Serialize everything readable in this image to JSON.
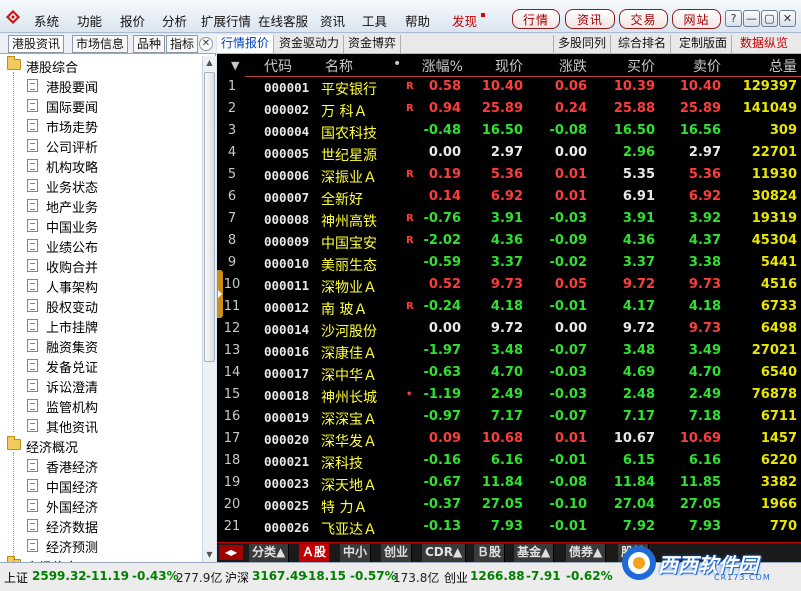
{
  "menu": [
    "系统",
    "功能",
    "报价",
    "分析",
    "扩展行情",
    "在线客服",
    "资讯",
    "工具",
    "帮助"
  ],
  "discover": "发现",
  "top_buttons": [
    "行情",
    "资讯",
    "交易",
    "网站"
  ],
  "window_buttons": [
    "?",
    "—",
    "▢",
    "✕"
  ],
  "left_tabs": [
    "港股资讯",
    "市场信息",
    "品种",
    "指标"
  ],
  "left_close": "✕",
  "tree": [
    {
      "label": "港股综合",
      "type": "folder"
    },
    {
      "label": "港股要闻",
      "type": "doc"
    },
    {
      "label": "国际要闻",
      "type": "doc"
    },
    {
      "label": "市场走势",
      "type": "doc"
    },
    {
      "label": "公司评析",
      "type": "doc"
    },
    {
      "label": "机构攻略",
      "type": "doc"
    },
    {
      "label": "业务状态",
      "type": "doc"
    },
    {
      "label": "地产业务",
      "type": "doc"
    },
    {
      "label": "中国业务",
      "type": "doc"
    },
    {
      "label": "业绩公布",
      "type": "doc"
    },
    {
      "label": "收购合并",
      "type": "doc"
    },
    {
      "label": "人事架构",
      "type": "doc"
    },
    {
      "label": "股权变动",
      "type": "doc"
    },
    {
      "label": "上市挂牌",
      "type": "doc"
    },
    {
      "label": "融资集资",
      "type": "doc"
    },
    {
      "label": "发备兑证",
      "type": "doc"
    },
    {
      "label": "诉讼澄清",
      "type": "doc"
    },
    {
      "label": "监管机构",
      "type": "doc"
    },
    {
      "label": "其他资讯",
      "type": "doc"
    },
    {
      "label": "经济概况",
      "type": "folder"
    },
    {
      "label": "香港经济",
      "type": "doc"
    },
    {
      "label": "中国经济",
      "type": "doc"
    },
    {
      "label": "外国经济",
      "type": "doc"
    },
    {
      "label": "经济数据",
      "type": "doc"
    },
    {
      "label": "经济预测",
      "type": "doc"
    },
    {
      "label": "市场信息",
      "type": "folder"
    }
  ],
  "right_tabs_left": [
    "行情报价",
    "资金驱动力",
    "资金博弈"
  ],
  "right_tabs_right": [
    "多股同列",
    "综合排名",
    "定制版面",
    "数据纵览"
  ],
  "columns": {
    "sort": "▼",
    "code": "代码",
    "name": "名称",
    "dot": "•",
    "pct": "涨幅%",
    "price": "现价",
    "chg": "涨跌",
    "buy": "买价",
    "sell": "卖价",
    "vol": "总量"
  },
  "rows": [
    {
      "i": "1",
      "code": "000001",
      "name": "平安银行",
      "flag": "R",
      "pct": "0.58",
      "price": "10.40",
      "chg": "0.06",
      "buy": "10.39",
      "sell": "10.40",
      "vol": "129397",
      "pc": "up",
      "prc": "up",
      "cc": "up",
      "bc": "up",
      "sc": "up"
    },
    {
      "i": "2",
      "code": "000002",
      "name": "万 科Ａ",
      "flag": "R",
      "pct": "0.94",
      "price": "25.89",
      "chg": "0.24",
      "buy": "25.88",
      "sell": "25.89",
      "vol": "141049",
      "pc": "up",
      "prc": "up",
      "cc": "up",
      "bc": "up",
      "sc": "up"
    },
    {
      "i": "3",
      "code": "000004",
      "name": "国农科技",
      "flag": "",
      "pct": "-0.48",
      "price": "16.50",
      "chg": "-0.08",
      "buy": "16.50",
      "sell": "16.56",
      "vol": "309",
      "pc": "down",
      "prc": "down",
      "cc": "down",
      "bc": "down",
      "sc": "down"
    },
    {
      "i": "4",
      "code": "000005",
      "name": "世纪星源",
      "flag": "",
      "pct": "0.00",
      "price": "2.97",
      "chg": "0.00",
      "buy": "2.96",
      "sell": "2.97",
      "vol": "22701",
      "pc": "flat",
      "prc": "flat",
      "cc": "flat",
      "bc": "down",
      "sc": "flat"
    },
    {
      "i": "5",
      "code": "000006",
      "name": "深振业Ａ",
      "flag": "R",
      "pct": "0.19",
      "price": "5.36",
      "chg": "0.01",
      "buy": "5.35",
      "sell": "5.36",
      "vol": "11930",
      "pc": "up",
      "prc": "up",
      "cc": "up",
      "bc": "flat",
      "sc": "up"
    },
    {
      "i": "6",
      "code": "000007",
      "name": "全新好",
      "flag": "",
      "pct": "0.14",
      "price": "6.92",
      "chg": "0.01",
      "buy": "6.91",
      "sell": "6.92",
      "vol": "30824",
      "pc": "up",
      "prc": "up",
      "cc": "up",
      "bc": "flat",
      "sc": "up"
    },
    {
      "i": "7",
      "code": "000008",
      "name": "神州高铁",
      "flag": "R",
      "pct": "-0.76",
      "price": "3.91",
      "chg": "-0.03",
      "buy": "3.91",
      "sell": "3.92",
      "vol": "19319",
      "pc": "down",
      "prc": "down",
      "cc": "down",
      "bc": "down",
      "sc": "down"
    },
    {
      "i": "8",
      "code": "000009",
      "name": "中国宝安",
      "flag": "R",
      "pct": "-2.02",
      "price": "4.36",
      "chg": "-0.09",
      "buy": "4.36",
      "sell": "4.37",
      "vol": "45304",
      "pc": "down",
      "prc": "down",
      "cc": "down",
      "bc": "down",
      "sc": "down"
    },
    {
      "i": "9",
      "code": "000010",
      "name": "美丽生态",
      "flag": "",
      "pct": "-0.59",
      "price": "3.37",
      "chg": "-0.02",
      "buy": "3.37",
      "sell": "3.38",
      "vol": "5441",
      "pc": "down",
      "prc": "down",
      "cc": "down",
      "bc": "down",
      "sc": "down"
    },
    {
      "i": "10",
      "code": "000011",
      "name": "深物业Ａ",
      "flag": "",
      "pct": "0.52",
      "price": "9.73",
      "chg": "0.05",
      "buy": "9.72",
      "sell": "9.73",
      "vol": "4516",
      "pc": "up",
      "prc": "up",
      "cc": "up",
      "bc": "up",
      "sc": "up"
    },
    {
      "i": "11",
      "code": "000012",
      "name": "南 玻Ａ",
      "flag": "R",
      "pct": "-0.24",
      "price": "4.18",
      "chg": "-0.01",
      "buy": "4.17",
      "sell": "4.18",
      "vol": "6733",
      "pc": "down",
      "prc": "down",
      "cc": "down",
      "bc": "down",
      "sc": "down"
    },
    {
      "i": "12",
      "code": "000014",
      "name": "沙河股份",
      "flag": "",
      "pct": "0.00",
      "price": "9.72",
      "chg": "0.00",
      "buy": "9.72",
      "sell": "9.73",
      "vol": "6498",
      "pc": "flat",
      "prc": "flat",
      "cc": "flat",
      "bc": "flat",
      "sc": "up"
    },
    {
      "i": "13",
      "code": "000016",
      "name": "深康佳Ａ",
      "flag": "",
      "pct": "-1.97",
      "price": "3.48",
      "chg": "-0.07",
      "buy": "3.48",
      "sell": "3.49",
      "vol": "27021",
      "pc": "down",
      "prc": "down",
      "cc": "down",
      "bc": "down",
      "sc": "down"
    },
    {
      "i": "14",
      "code": "000017",
      "name": "深中华Ａ",
      "flag": "",
      "pct": "-0.63",
      "price": "4.70",
      "chg": "-0.03",
      "buy": "4.69",
      "sell": "4.70",
      "vol": "6540",
      "pc": "down",
      "prc": "down",
      "cc": "down",
      "bc": "down",
      "sc": "down"
    },
    {
      "i": "15",
      "code": "000018",
      "name": "神州长城",
      "flag": "•",
      "pct": "-1.19",
      "price": "2.49",
      "chg": "-0.03",
      "buy": "2.48",
      "sell": "2.49",
      "vol": "76878",
      "pc": "down",
      "prc": "down",
      "cc": "down",
      "bc": "down",
      "sc": "down"
    },
    {
      "i": "16",
      "code": "000019",
      "name": "深深宝Ａ",
      "flag": "",
      "pct": "-0.97",
      "price": "7.17",
      "chg": "-0.07",
      "buy": "7.17",
      "sell": "7.18",
      "vol": "6711",
      "pc": "down",
      "prc": "down",
      "cc": "down",
      "bc": "down",
      "sc": "down"
    },
    {
      "i": "17",
      "code": "000020",
      "name": "深华发Ａ",
      "flag": "",
      "pct": "0.09",
      "price": "10.68",
      "chg": "0.01",
      "buy": "10.67",
      "sell": "10.69",
      "vol": "1457",
      "pc": "up",
      "prc": "up",
      "cc": "up",
      "bc": "flat",
      "sc": "up"
    },
    {
      "i": "18",
      "code": "000021",
      "name": "深科技",
      "flag": "",
      "pct": "-0.16",
      "price": "6.16",
      "chg": "-0.01",
      "buy": "6.15",
      "sell": "6.16",
      "vol": "6220",
      "pc": "down",
      "prc": "down",
      "cc": "down",
      "bc": "down",
      "sc": "down"
    },
    {
      "i": "19",
      "code": "000023",
      "name": "深天地Ａ",
      "flag": "",
      "pct": "-0.67",
      "price": "11.84",
      "chg": "-0.08",
      "buy": "11.84",
      "sell": "11.85",
      "vol": "3382",
      "pc": "down",
      "prc": "down",
      "cc": "down",
      "bc": "down",
      "sc": "down"
    },
    {
      "i": "20",
      "code": "000025",
      "name": "特 力Ａ",
      "flag": "",
      "pct": "-0.37",
      "price": "27.05",
      "chg": "-0.10",
      "buy": "27.04",
      "sell": "27.05",
      "vol": "1966",
      "pc": "down",
      "prc": "down",
      "cc": "down",
      "bc": "down",
      "sc": "down"
    },
    {
      "i": "21",
      "code": "000026",
      "name": "飞亚达Ａ",
      "flag": "",
      "pct": "-0.13",
      "price": "7.93",
      "chg": "-0.01",
      "buy": "7.92",
      "sell": "7.93",
      "vol": "770",
      "pc": "down",
      "prc": "down",
      "cc": "down",
      "bc": "down",
      "sc": "down"
    }
  ],
  "bottom_tabs": [
    "分类▲",
    "Ａ股",
    "中小",
    "创业",
    "CDR▲",
    "Ｂ股",
    "基金▲",
    "债券▲",
    "股转"
  ],
  "status": {
    "sh_label": "上证",
    "sh_value": "2599.32",
    "sh_chg": "-11.19",
    "sh_pct": "-0.43%",
    "sh_amt": "277.9亿",
    "hs_label": "沪深",
    "hs_value": "3167.49",
    "hs_chg": "-18.15",
    "hs_pct": "-0.57%",
    "hs_amt": "173.8亿",
    "cy_label": "创业",
    "cy_value": "1266.88",
    "cy_chg": "-7.91",
    "cy_pct": "-0.62%"
  },
  "watermark": {
    "text": "西西软件园",
    "sub": "CR173.COM"
  },
  "colors": {
    "up": "#ff3c3c",
    "down": "#2fe22f",
    "name": "#ffff33",
    "volume": "#e9e600",
    "accent": "#c00000"
  }
}
